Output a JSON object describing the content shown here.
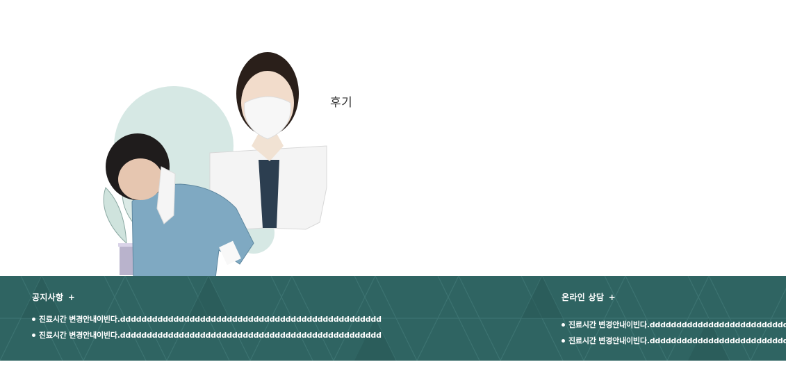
{
  "hero": {
    "review_label": "후기"
  },
  "footer": {
    "notice": {
      "title": "공지사항",
      "more": "+",
      "posts": [
        {
          "title": "진료시간 변경안내이빈다.ddddddddddddddddddddddddddddddddddddddddddddddddd"
        },
        {
          "title": "진료시간 변경안내이빈다.ddddddddddddddddddddddddddddddddddddddddddddddddd"
        }
      ]
    },
    "consult": {
      "title": "온라인 상담",
      "more": "+",
      "posts": [
        {
          "title": "진료시간 변경안내이빈다.ddddddddddddddddddddddddddddddddddddddddddddddddd"
        },
        {
          "title": "진료시간 변경안내이빈다.ddddddddddddddddddddddddddddddddddddddddddddddddd"
        }
      ]
    }
  },
  "colors": {
    "footer_bg": "#2f6462",
    "accent_circle": "#d6e8e4",
    "scrub_blue": "#7fa9c2"
  },
  "icons": {
    "bullet": "bullet-dot-icon",
    "illustration": "doctors-illustration"
  }
}
